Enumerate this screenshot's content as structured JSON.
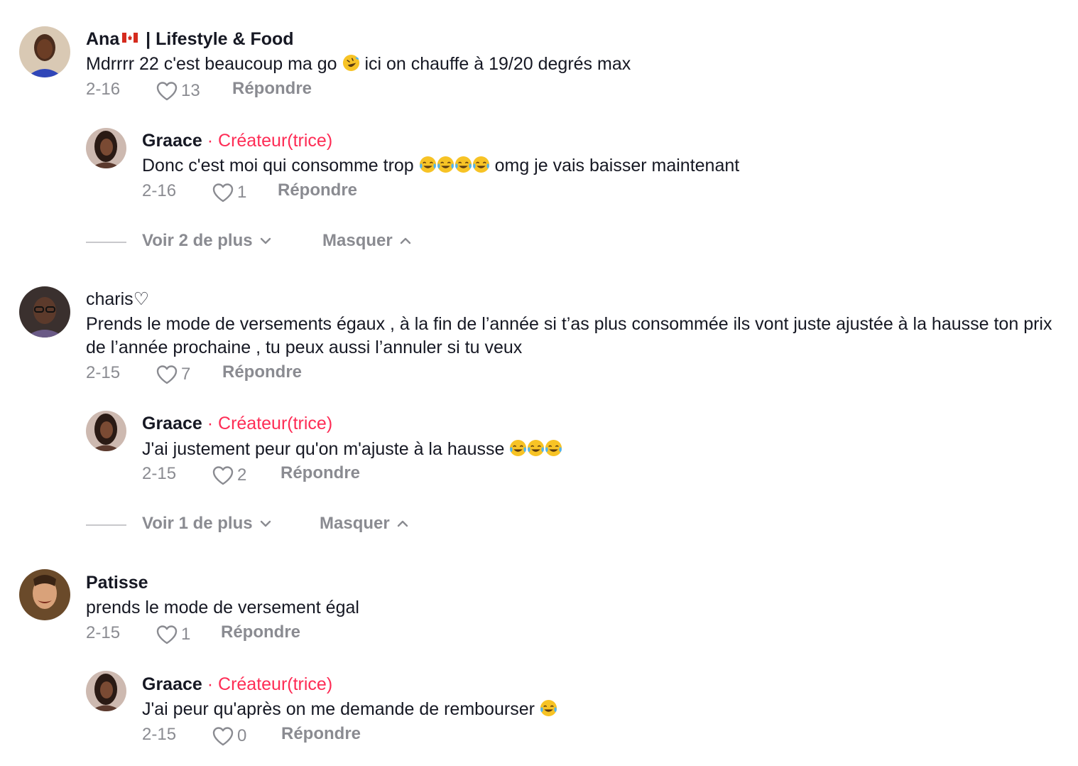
{
  "comments": [
    {
      "username": "Ana",
      "username_suffix": " | Lifestyle & Food",
      "text_before": "Mdrrrr 22 c'est beaucoup ma go ",
      "text_after": " ici on chauffe à 19/20 degrés max",
      "date": "2-16",
      "likes": "13",
      "reply_label": "Répondre",
      "reply": {
        "username": "Graace",
        "creator_badge": "Créateur(trice)",
        "text_before": "Donc c'est moi qui consomme trop ",
        "text_after": " omg je vais baisser maintenant",
        "date": "2-16",
        "likes": "1",
        "reply_label": "Répondre"
      },
      "view_more": "Voir 2 de plus",
      "hide": "Masquer"
    },
    {
      "username": "charis♡",
      "text": "Prends le mode de versements égaux , à la fin de l’année si t’as plus consommée ils vont juste ajustée à la hausse ton prix de l’année prochaine , tu peux aussi l’annuler si tu veux",
      "date": "2-15",
      "likes": "7",
      "reply_label": "Répondre",
      "reply": {
        "username": "Graace",
        "creator_badge": "Créateur(trice)",
        "text_before": "J'ai justement peur qu'on m'ajuste à la hausse ",
        "date": "2-15",
        "likes": "2",
        "reply_label": "Répondre"
      },
      "view_more": "Voir 1 de plus",
      "hide": "Masquer"
    },
    {
      "username": "Patisse",
      "text": "prends le mode de versement égal",
      "date": "2-15",
      "likes": "1",
      "reply_label": "Répondre",
      "reply": {
        "username": "Graace",
        "creator_badge": "Créateur(trice)",
        "text_before": "J'ai peur qu'après on me demande de rembourser ",
        "date": "2-15",
        "likes": "0",
        "reply_label": "Répondre"
      }
    }
  ],
  "colors": {
    "creator": "#fe2c55",
    "meta": "#8a8b91",
    "text": "#161823"
  },
  "icons": [
    "heart-icon",
    "chevron-down-icon",
    "chevron-up-icon",
    "canada-flag-icon",
    "rofl-emoji-icon",
    "joy-emoji-icon"
  ]
}
